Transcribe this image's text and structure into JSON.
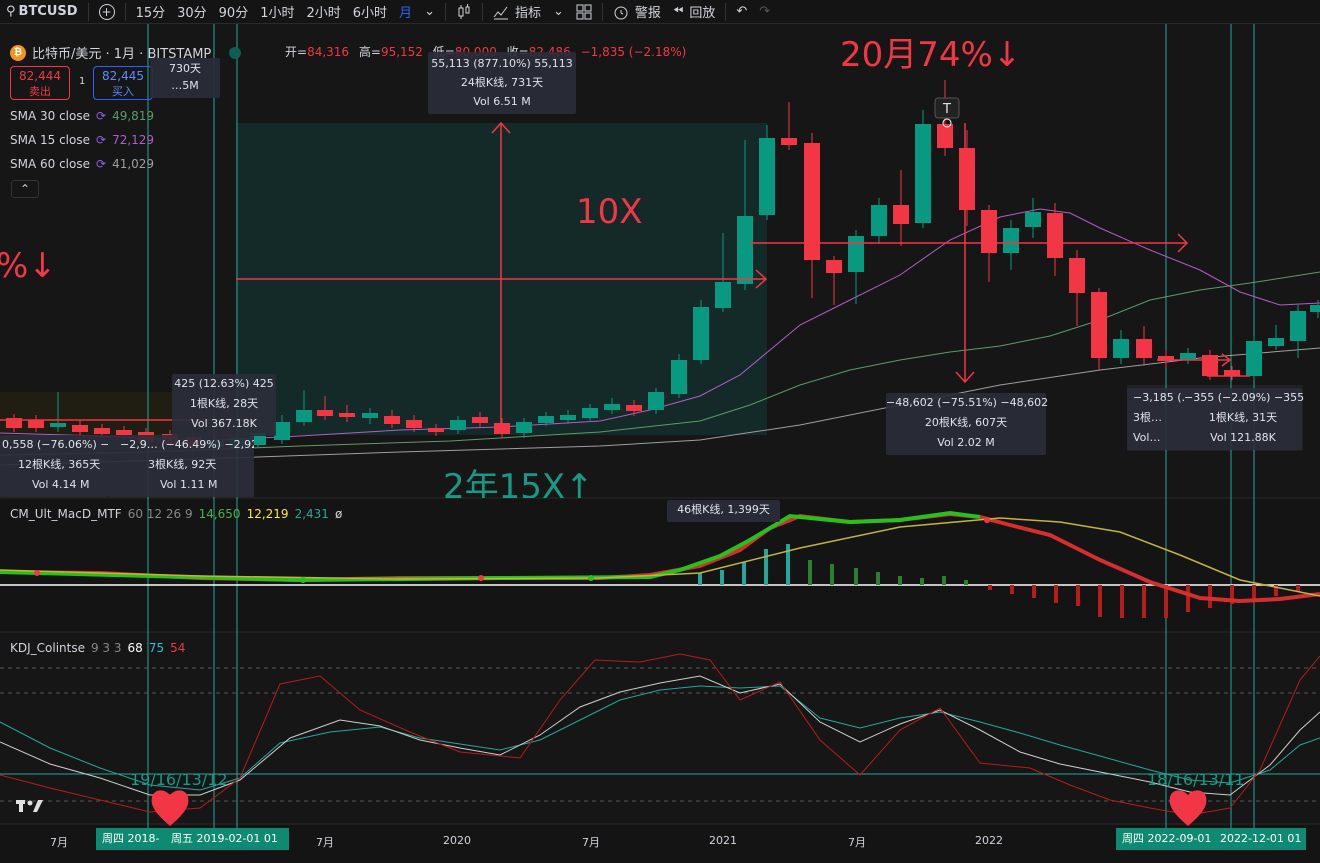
{
  "toolbar": {
    "symbol": "BTCUSD",
    "timeframes": [
      "15分",
      "30分",
      "90分",
      "1小时",
      "2小时",
      "6小时",
      "月"
    ],
    "active_timeframe": "月",
    "indicators_label": "指标",
    "alerts_label": "警报",
    "replay_label": "回放"
  },
  "legend": {
    "title": "比特币/美元 · 1月 · BITSTAMP",
    "open_label": "开=",
    "open": "84,316",
    "high_label": "高=",
    "high": "95,152",
    "low_label": "低=",
    "low": "80,000",
    "close_label": "收=",
    "close": "82,486",
    "change": "−1,835 (−2.18%)",
    "sell_price": "82,444",
    "sell_label": "卖出",
    "spread": "1",
    "buy_price": "82,445",
    "buy_label": "买入",
    "sma": [
      {
        "label": "SMA 30 close",
        "value": "49,819",
        "color": "#5b9a6b"
      },
      {
        "label": "SMA 15 close",
        "value": "72,129",
        "color": "#b15fc4"
      },
      {
        "label": "SMA 60 close",
        "value": "41,029",
        "color": "#9e9e9e"
      }
    ]
  },
  "annotations": {
    "pct_20m": "20月74%↓",
    "tenx": "10X",
    "pct_left": "%↓",
    "years": "2年15X↑",
    "kdj_low_left": "19/16/13/12",
    "kdj_low_right": "18/16/13/11"
  },
  "tooltips": [
    {
      "l1": "730天",
      "l2": "…5M"
    },
    {
      "l1": "55,113 (877.10%) 55,113",
      "l2": "24根K线, 731天",
      "l3": "Vol 6.51 M"
    },
    {
      "l1": "425 (12.63%) 425",
      "l2": "1根K线, 28天",
      "l3": "Vol 367.18K"
    },
    {
      "l1": "−48,602 (−75.51%) −48,602",
      "l2": "20根K线, 607天",
      "l3": "Vol 2.02 M"
    },
    {
      "l1": "−3,185 (…",
      "l2": "3根…",
      "l3": "Vol…"
    },
    {
      "l1": "−355 (−2.09%) −355",
      "l2": "1根K线, 31天",
      "l3": "Vol 121.88K"
    },
    {
      "l1": "0,558 (−76.06%) −10…",
      "l2": "12根K线, 365天",
      "l3": "Vol 4.14 M"
    },
    {
      "l1": "−2,9… (−46.49%) −2,923",
      "l2": "3根K线, 92天",
      "l3": "Vol 1.11 M"
    },
    {
      "l1": "46根K线, 1,399天"
    }
  ],
  "macd": {
    "label": "CM_Ult_MacD_MTF",
    "params": "60 12 26 9",
    "v1": "14,650",
    "v2": "12,219",
    "v3": "2,431",
    "v4": "ø",
    "colors": {
      "v1": "#4caf50",
      "v2": "#ffeb3b",
      "v3": "#26a69a"
    }
  },
  "kdj": {
    "label": "KDJ_Colintse",
    "params": "9 3 3",
    "k": "68",
    "d": "75",
    "j": "54",
    "colors": {
      "k": "#ffffff",
      "d": "#26c6da",
      "j": "#f23645"
    }
  },
  "time_axis": {
    "labels": [
      "7月",
      "7月",
      "2020",
      "7月",
      "2021",
      "7月",
      "2022"
    ],
    "box_left_a": "周四 2018-",
    "box_left_b": "周五 2019-02-01   01",
    "box_right_a": "周四 2022-09-01",
    "box_right_b": "2022-12-01   01"
  },
  "colors": {
    "up": "#089981",
    "down": "#f23645",
    "accent": "#2962ff"
  }
}
